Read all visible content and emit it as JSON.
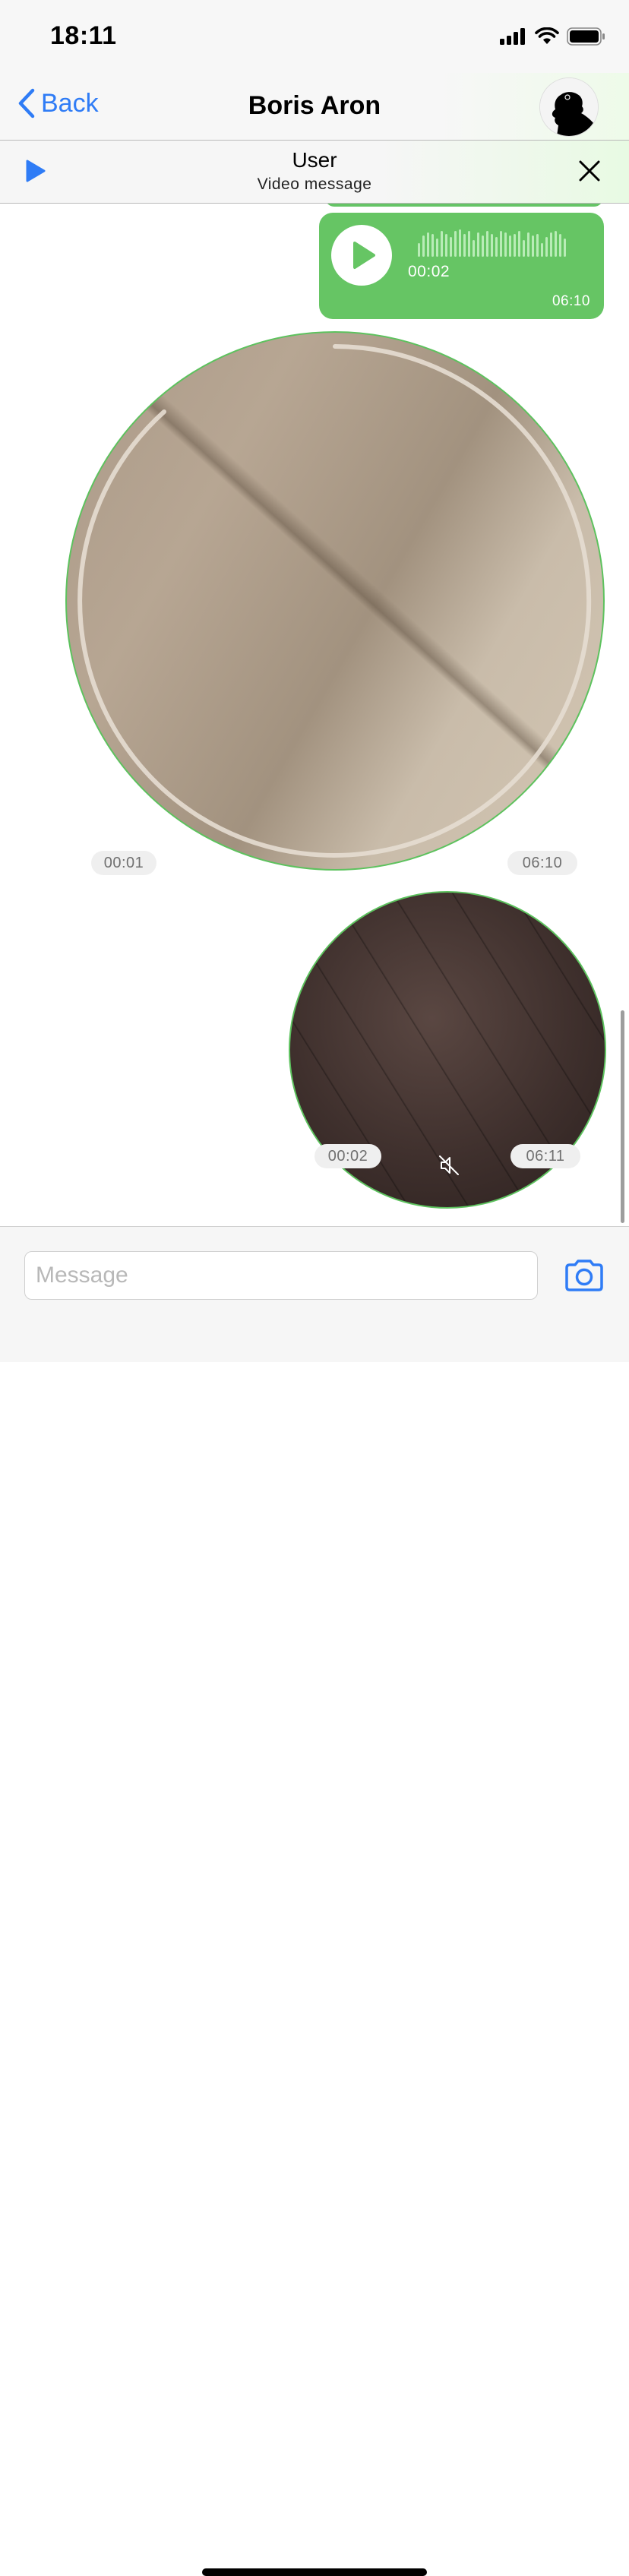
{
  "status_bar": {
    "time": "18:11"
  },
  "nav": {
    "back_label": "Back",
    "title": "Boris Aron"
  },
  "player": {
    "title": "User",
    "subtitle": "Video message"
  },
  "messages": {
    "voice": {
      "duration": "00:02",
      "time": "06:10"
    },
    "video_large": {
      "duration": "00:01",
      "time": "06:10"
    },
    "video_small": {
      "duration": "00:02",
      "time": "06:11"
    }
  },
  "composer": {
    "placeholder": "Message"
  },
  "colors": {
    "accent_blue": "#2f7cf6",
    "bubble_green": "#66c564",
    "video_border": "#5dc25e"
  },
  "icons": {
    "back": "chevron-left-icon",
    "player_play": "play-icon",
    "player_close": "close-icon",
    "voice_play": "play-icon",
    "mute": "speaker-muted-icon",
    "camera": "camera-icon"
  }
}
